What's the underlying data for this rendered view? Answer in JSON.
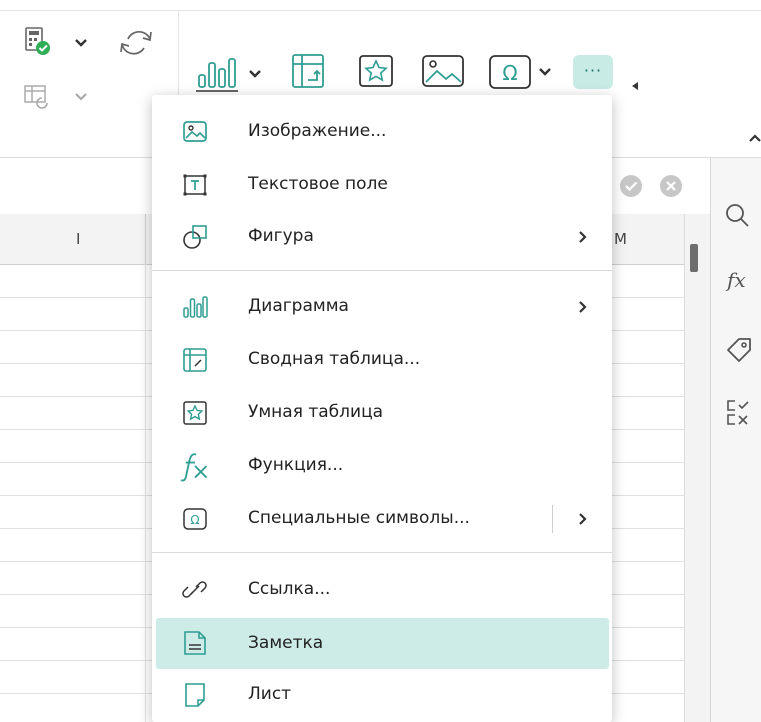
{
  "toolbar": {
    "groups": [
      "calc-options",
      "recalculate",
      "insert"
    ],
    "insert_icons": [
      "bar-chart-icon",
      "pivot-table-icon",
      "smart-table-icon",
      "image-icon",
      "special-symbols-icon",
      "more-icon"
    ],
    "more_label": "···"
  },
  "grid": {
    "columns": [
      "I",
      "M"
    ]
  },
  "side_panel": {
    "icons": [
      "search-icon",
      "fx-icon",
      "tag-icon",
      "check-cross-icon"
    ],
    "fx_label": "fx"
  },
  "menu": {
    "items": [
      {
        "label": "Изображение...",
        "icon": "image-icon",
        "submenu": false
      },
      {
        "label": "Текстовое поле",
        "icon": "text-box-icon",
        "submenu": false
      },
      {
        "label": "Фигура",
        "icon": "shape-icon",
        "submenu": true
      },
      {
        "label": "Диаграмма",
        "icon": "chart-icon",
        "submenu": true
      },
      {
        "label": "Сводная таблица...",
        "icon": "pivot-table-icon",
        "submenu": false
      },
      {
        "label": "Умная таблица",
        "icon": "smart-table-icon",
        "submenu": false
      },
      {
        "label": "Функция...",
        "icon": "function-icon",
        "submenu": false
      },
      {
        "label": "Специальные символы...",
        "icon": "special-symbols-icon",
        "submenu": true
      },
      {
        "label": "Ссылка...",
        "icon": "link-icon",
        "submenu": false
      },
      {
        "label": "Заметка",
        "icon": "note-icon",
        "submenu": false,
        "highlighted": true
      },
      {
        "label": "Лист",
        "icon": "sheet-icon",
        "submenu": false
      }
    ]
  },
  "colors": {
    "accent": "#2f9e93",
    "highlight": "#cdebe7",
    "more_button": "#c9ebe6"
  }
}
